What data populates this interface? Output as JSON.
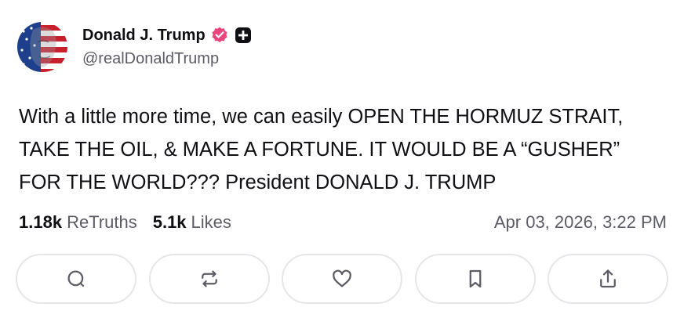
{
  "author": {
    "display_name": "Donald J. Trump",
    "handle": "@realDonaldTrump",
    "verified_badge_icon": "verified-badge-icon",
    "platform_badge_icon": "plus-badge-icon"
  },
  "post": {
    "text": "With a little more time, we can easily OPEN THE HORMUZ STRAIT, TAKE THE OIL, & MAKE A FORTUNE. IT WOULD BE A “GUSHER” FOR THE WORLD??? President DONALD J. TRUMP"
  },
  "stats": {
    "retruths_count": "1.18k",
    "retruths_label": "ReTruths",
    "likes_count": "5.1k",
    "likes_label": "Likes",
    "timestamp": "Apr 03, 2026, 3:22 PM"
  },
  "actions": [
    {
      "name": "reply",
      "icon": "reply-icon"
    },
    {
      "name": "retruth",
      "icon": "retruth-icon"
    },
    {
      "name": "like",
      "icon": "heart-icon"
    },
    {
      "name": "bookmark",
      "icon": "bookmark-icon"
    },
    {
      "name": "share",
      "icon": "share-icon"
    }
  ],
  "colors": {
    "text_primary": "#0f0f14",
    "text_secondary": "#5c5c66",
    "verified_badge": "#e8467c",
    "button_border": "#e6e6ea"
  }
}
